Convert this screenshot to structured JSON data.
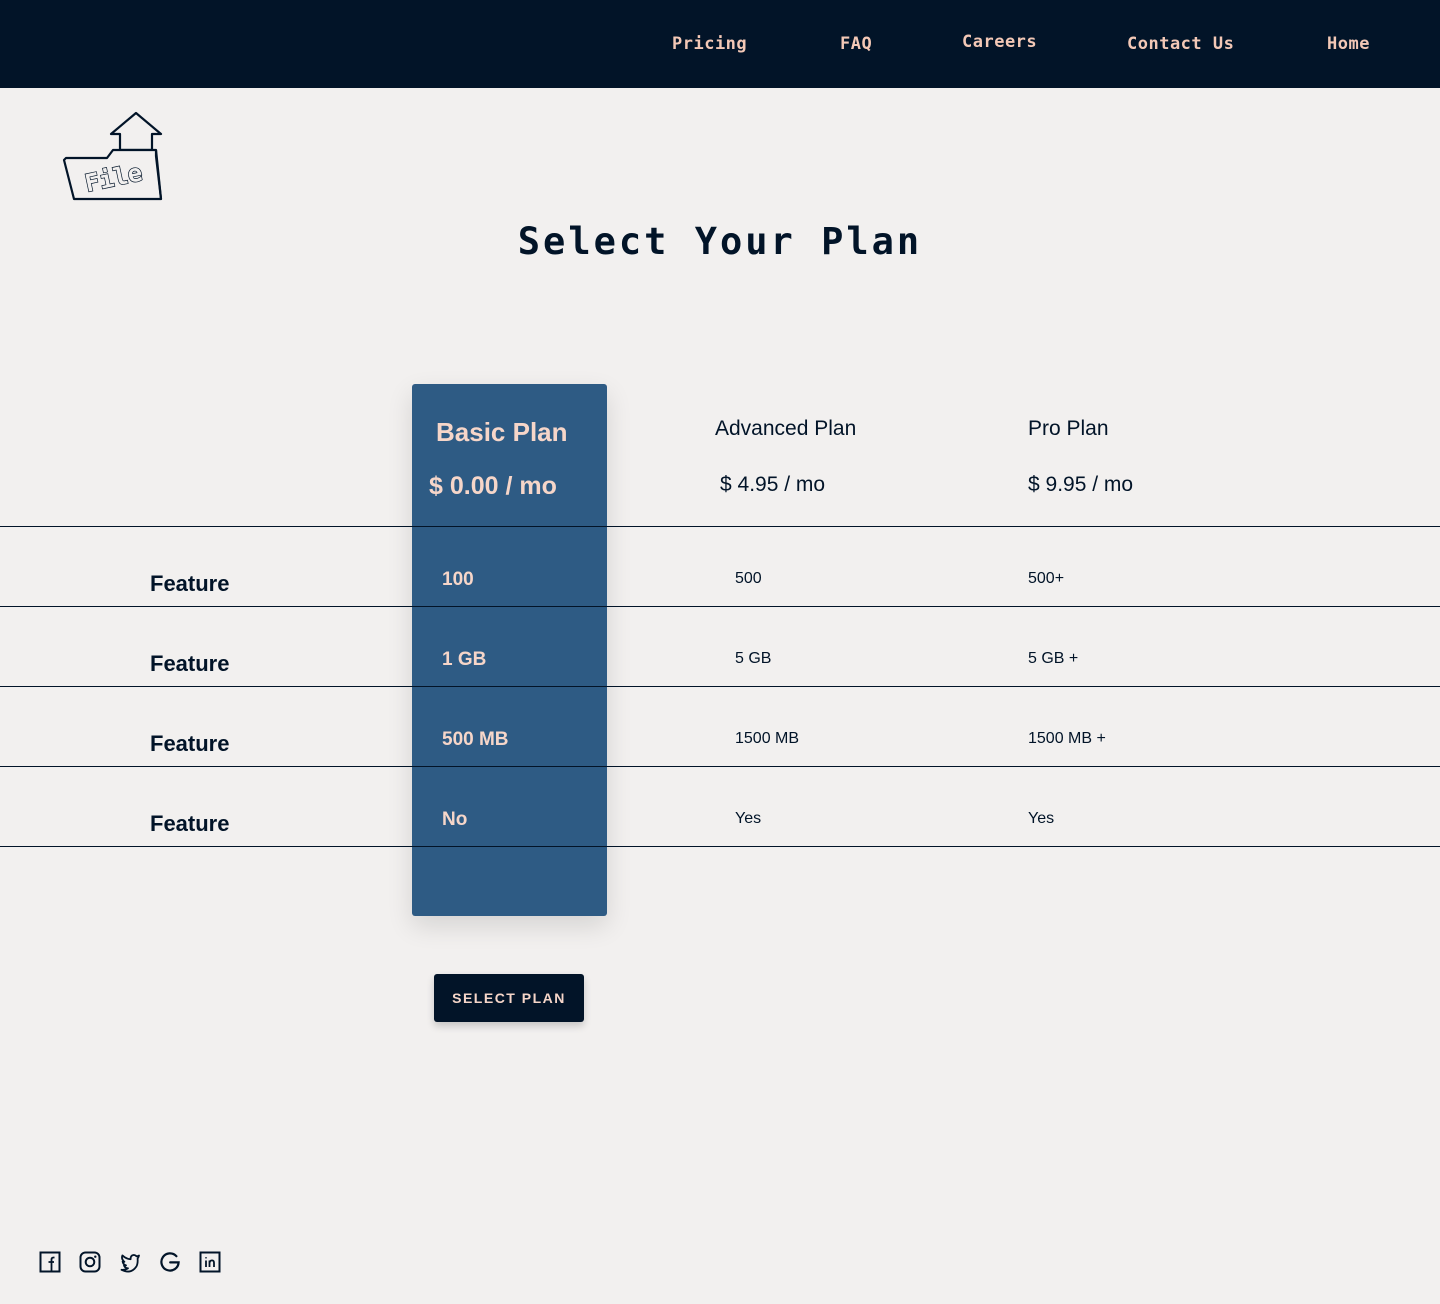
{
  "nav": {
    "links": [
      "Pricing",
      "FAQ",
      "Careers",
      "Contact Us",
      "Home"
    ]
  },
  "logo": {
    "text": "File"
  },
  "page_title": "Select Your Plan",
  "plans": [
    {
      "name": "Basic Plan",
      "price": "$ 0.00 / mo",
      "values": [
        "100",
        "1 GB",
        "500 MB",
        "No"
      ]
    },
    {
      "name": "Advanced Plan",
      "price": "$ 4.95 / mo",
      "values": [
        "500",
        "5 GB",
        "1500 MB",
        "Yes"
      ]
    },
    {
      "name": "Pro Plan",
      "price": "$ 9.95 / mo",
      "values": [
        "500+",
        "5 GB +",
        "1500 MB +",
        "Yes"
      ]
    }
  ],
  "features": [
    "Feature",
    "Feature",
    "Feature",
    "Feature"
  ],
  "select_button": "SELECT PLAN",
  "social_icons": [
    "facebook-icon",
    "instagram-icon",
    "twitter-icon",
    "google-icon",
    "linkedin-icon"
  ],
  "colors": {
    "navy": "#021428",
    "accent_blue": "#2e5b84",
    "peach": "#f3c8b6",
    "background": "#f2f0ef"
  }
}
